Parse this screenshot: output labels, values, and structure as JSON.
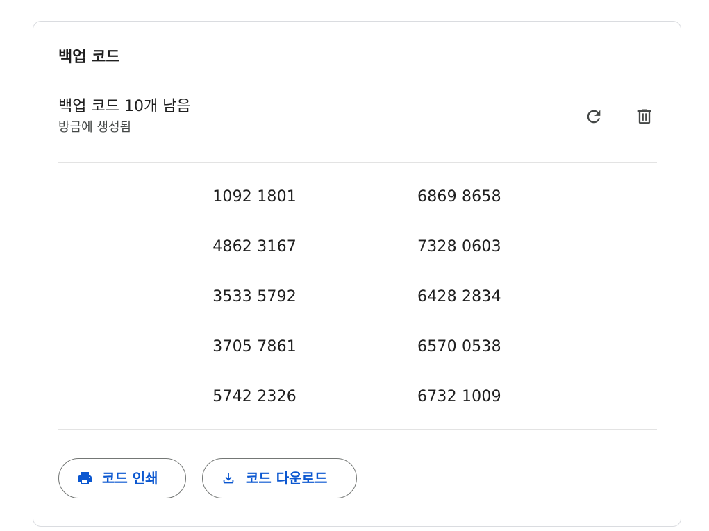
{
  "card": {
    "title": "백업 코드"
  },
  "summary": {
    "remaining": "백업 코드 10개 남음",
    "generated": "방금에 생성됨"
  },
  "actions": {
    "refresh_icon": "refresh-icon",
    "delete_icon": "trash-icon"
  },
  "codes": [
    [
      "1092 1801",
      "6869 8658"
    ],
    [
      "4862 3167",
      "7328 0603"
    ],
    [
      "3533 5792",
      "6428 2834"
    ],
    [
      "3705 7861",
      "6570 0538"
    ],
    [
      "5742 2326",
      "6732 1009"
    ]
  ],
  "buttons": {
    "print_label": "코드 인쇄",
    "print_icon": "printer-icon",
    "download_label": "코드 다운로드",
    "download_icon": "download-icon"
  },
  "colors": {
    "accent": "#0b57d0",
    "text": "#1f1f1f",
    "subtext": "#444746",
    "divider": "#e3e3e3",
    "border": "#dadce0",
    "icon": "#444746"
  }
}
